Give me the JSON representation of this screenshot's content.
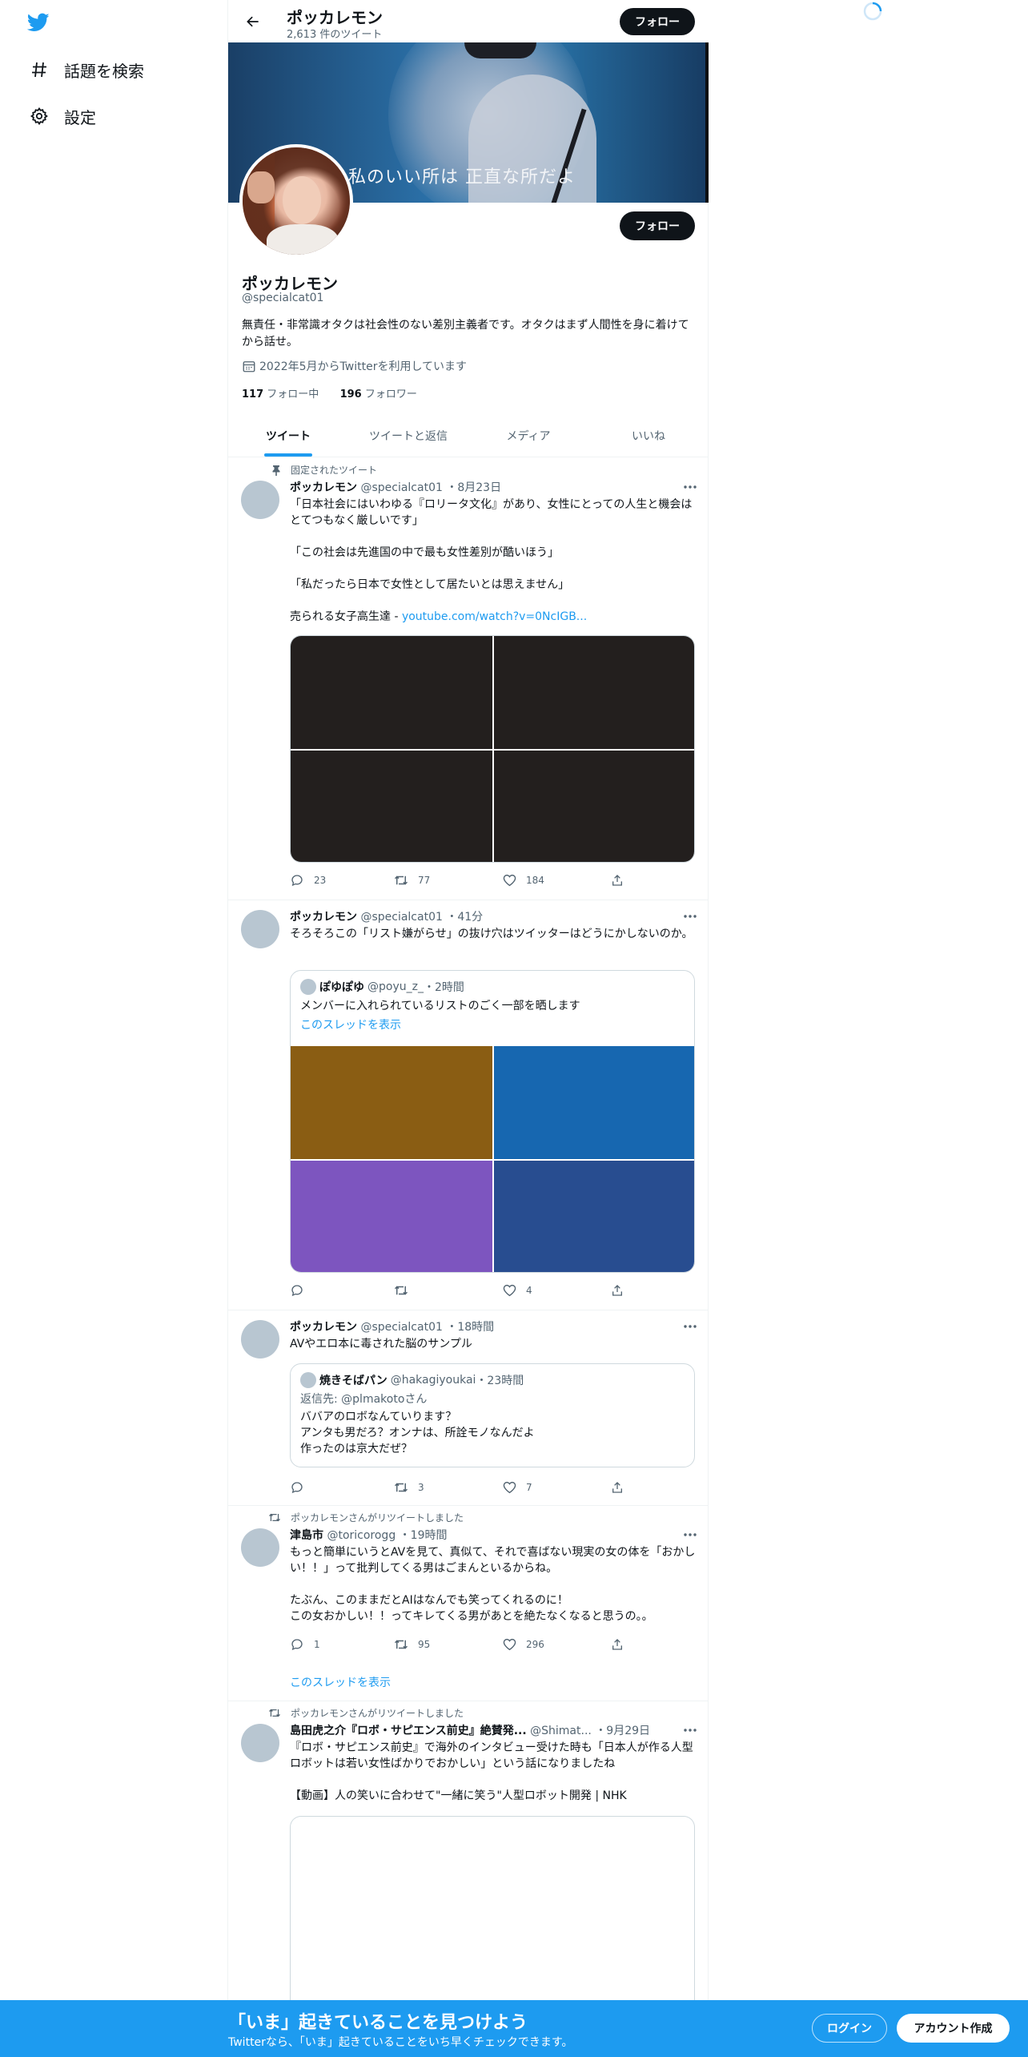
{
  "sidebar": {
    "logo": "twitter-bird-icon",
    "items": [
      {
        "icon": "hashtag-icon",
        "label": "話題を検索"
      },
      {
        "icon": "gear-icon",
        "label": "設定"
      }
    ]
  },
  "header": {
    "name": "ポッカレモン",
    "tweet_count": "2,613 件のツイート",
    "follow_label": "フォロー"
  },
  "profile": {
    "banner_text": "私のいい所は 正直な所だよ",
    "follow_label": "フォロー",
    "name": "ポッカレモン",
    "handle": "@specialcat01",
    "bio": "無責任・非常識オタクは社会性のない差別主義者です。オタクはまず人間性を身に着けてから話せ。",
    "joined": "2022年5月からTwitterを利用しています",
    "following_count": "117",
    "following_label": "フォロー中",
    "followers_count": "196",
    "followers_label": "フォロワー"
  },
  "tabs": [
    "ツイート",
    "ツイートと返信",
    "メディア",
    "いいね"
  ],
  "tweets": [
    {
      "pinned_label": "固定されたツイート",
      "name": "ポッカレモン",
      "handle": "@specialcat01",
      "time": "・8月23日",
      "text": "「日本社会にはいわゆる『ロリータ文化』があり、女性にとっての人生と機会はとてつもなく厳しいです」\n\n「この社会は先進国の中で最も女性差別が酷いほう」\n\n「私だったら日本で女性として居たいとは思えません」\n\n売られる女子高生達 - ",
      "link": "youtube.com/watch?v=0NcIGB...",
      "media_colors": [
        "#231f1e",
        "#231f1e",
        "#231f1e",
        "#231f1e"
      ],
      "reply": "23",
      "retweet": "77",
      "like": "184"
    },
    {
      "name": "ポッカレモン",
      "handle": "@specialcat01",
      "time": "・41分",
      "text": "そろそろこの「リスト嫌がらせ」の抜け穴はツイッターはどうにかしないのか。",
      "quote": {
        "name": "ぽゆぽゆ",
        "handle": "@poyu_z_",
        "time": "・2時間",
        "text": "メンバーに入れられているリストのごく一部を晒します",
        "thread_link": "このスレッドを表示",
        "media_colors": [
          "#8a5d13",
          "#1767b0",
          "#7d55bf",
          "#284d90"
        ]
      },
      "reply": "",
      "retweet": "",
      "like": "4"
    },
    {
      "name": "ポッカレモン",
      "handle": "@specialcat01",
      "time": "・18時間",
      "text": "AVやエロ本に毒された脳のサンプル",
      "quote": {
        "name": "焼きそばパン",
        "handle": "@hakagiyoukai",
        "time": "・23時間",
        "reply_to": "返信先: @plmakotoさん",
        "text": "ババアのロボなんていります？\nアンタも男だろ？オンナは、所詮モノなんだよ\n作ったのは京大だぜ？"
      },
      "reply": "",
      "retweet": "3",
      "like": "7"
    },
    {
      "social": "ポッカレモンさんがリツイートしました",
      "name": "津島市",
      "handle": "@toricorogg",
      "time": "・19時間",
      "text": "もっと簡単にいうとAVを見て、真似て、それで喜ばない現実の女の体を「おかしい！！」って批判してくる男はごまんといるからね。\n\nたぶん、このままだとAIはなんでも笑ってくれるのに！\nこの女おかしい！！ってキレてくる男があとを絶たなくなると思うの。。",
      "reply": "1",
      "retweet": "95",
      "like": "296",
      "thread_link": "このスレッドを表示"
    },
    {
      "social": "ポッカレモンさんがリツイートしました",
      "name": "島田虎之介『ロボ・サピエンス前史』絶賛発...",
      "handle": "@Shimat...",
      "time": "・9月29日",
      "text": "『ロボ・サピエンス前史』で海外のインタビュー受けた時も「日本人が作る人型ロボットは若い女性ばかりでおかしい」という話になりましたね\n\n【動画】人の笑いに合わせて\"一緒に笑う\"人型ロボット開発 | NHK"
    }
  ],
  "bottom_bar": {
    "title": "「いま」起きていることを見つけよう",
    "subtitle": "Twitterなら、「いま」起きていることをいち早くチェックできます。",
    "login_label": "ログイン",
    "signup_label": "アカウント作成"
  },
  "colors": {
    "accent": "#1d9bf0",
    "text": "#0f1419",
    "secondary": "#536471"
  }
}
